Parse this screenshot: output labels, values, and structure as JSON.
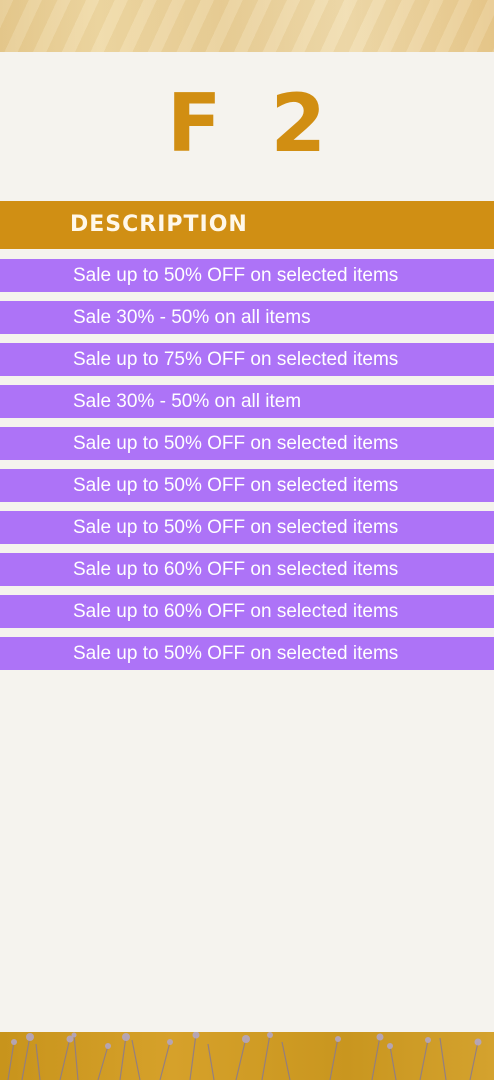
{
  "floor": {
    "letter": "F",
    "number": "2"
  },
  "header": {
    "label": "DESCRIPTION"
  },
  "items": [
    {
      "text": "Sale up to 50% OFF on selected items"
    },
    {
      "text": "Sale 30% - 50% on all items"
    },
    {
      "text": "Sale up to 75% OFF on selected items"
    },
    {
      "text": "Sale 30% - 50% on all item"
    },
    {
      "text": "Sale up to 50% OFF on selected items"
    },
    {
      "text": "Sale up to 50% OFF on selected items"
    },
    {
      "text": "Sale up to 50% OFF on selected items"
    },
    {
      "text": "Sale up to 60% OFF on selected items"
    },
    {
      "text": "Sale up to 60% OFF on selected items"
    },
    {
      "text": "Sale up to 50% OFF on selected items"
    }
  ],
  "colors": {
    "accent_gold": "#d08f14",
    "row_purple": "#ad73f7",
    "background": "#f5f3ee"
  }
}
